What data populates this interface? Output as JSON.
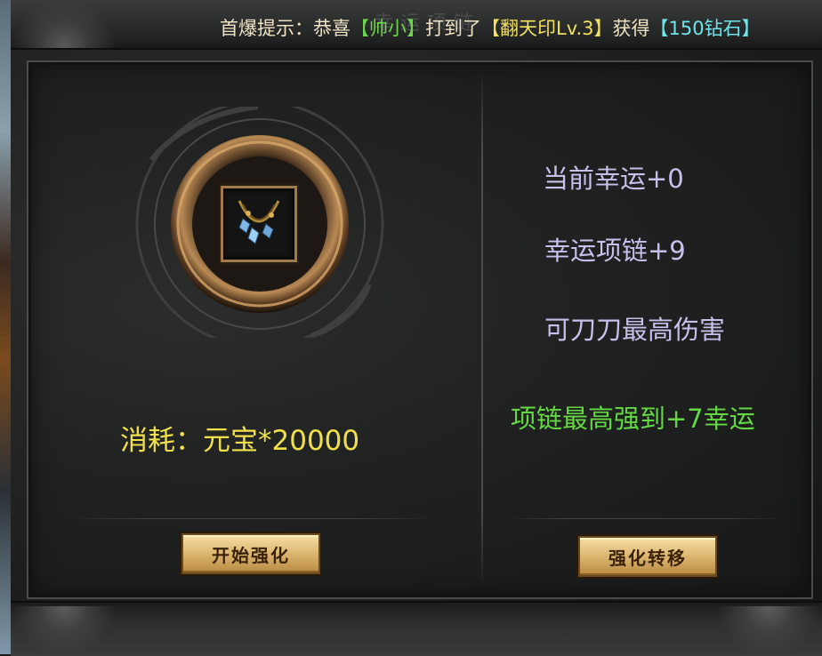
{
  "header": {
    "title_faint": "幸运项链",
    "ticker": {
      "prefix": "首爆提示：恭喜",
      "player": "【帅小】",
      "mid": "打到了",
      "item": "【翻天印Lv.3】",
      "got": "获得",
      "reward": "【150钻石】"
    }
  },
  "left_panel": {
    "equip_icon": "necklace-icon",
    "cost_text": "消耗：元宝*20000",
    "start_button": "开始强化"
  },
  "right_panel": {
    "lines": [
      "当前幸运+0",
      "幸运项链+9",
      "可刀刀最高伤害"
    ],
    "highlight": "项链最高强到+7幸运",
    "transfer_button": "强化转移"
  },
  "colors": {
    "ticker_text": "#efe3c4",
    "player_green": "#6cd64c",
    "item_yellow": "#f2e060",
    "reward_cyan": "#6fe4ea",
    "cost_yellow": "#f0e04a",
    "info_lavender": "#c6c0ea",
    "highlight_green": "#63d843",
    "button_gold": "#dcb670"
  }
}
